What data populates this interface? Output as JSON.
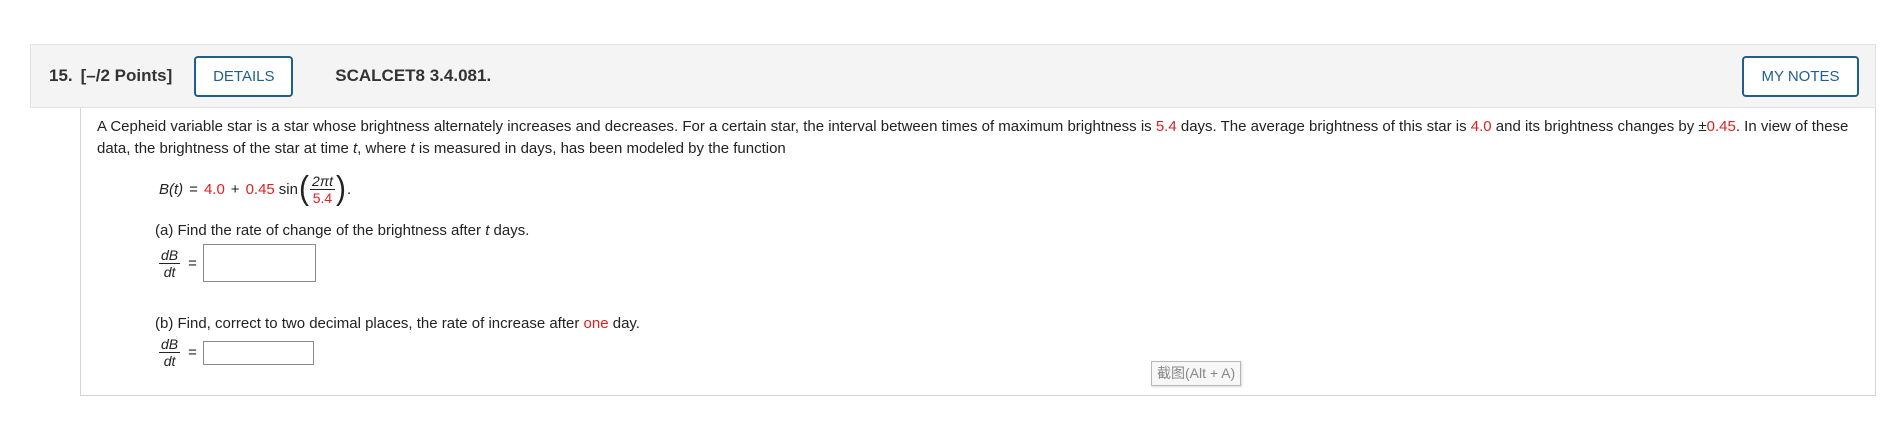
{
  "header": {
    "question_number": "15.",
    "points": "[–/2 Points]",
    "details_button": "DETAILS",
    "problem_code": "SCALCET8 3.4.081.",
    "notes_button": "MY NOTES"
  },
  "problem": {
    "text_1": "A Cepheid variable star is a star whose brightness alternately increases and decreases. For a certain star, the interval between times of maximum brightness is ",
    "period": "5.4",
    "text_2": " days. The average brightness of this star is ",
    "average": "4.0",
    "text_3": " and its brightness changes by ±",
    "change": "0.45",
    "text_4": ". In view of these data, the brightness of the star at time ",
    "var_t": "t",
    "text_5": ", where ",
    "text_6": " is measured in days, has been modeled by the function"
  },
  "formula": {
    "lhs": "B(t)",
    "eq": "=",
    "constant": "4.0",
    "plus": "+",
    "amplitude": "0.45",
    "func": "sin",
    "numerator": "2πt",
    "denominator": "5.4",
    "end": "."
  },
  "part_a": {
    "text": "(a) Find the rate of change of the brightness after ",
    "var": "t",
    "text_end": " days.",
    "deriv_num": "dB",
    "deriv_den": "dt",
    "eq": "=",
    "answer_value": ""
  },
  "part_b": {
    "text": "(b) Find, correct to two decimal places, the rate of increase after ",
    "highlight": "one",
    "text_end": " day.",
    "deriv_num": "dB",
    "deriv_den": "dt",
    "eq": "=",
    "answer_value": ""
  },
  "tooltip": "截图(Alt + A)",
  "colors": {
    "accent": "#1f5f8b",
    "highlight": "#e02020",
    "header_bg": "#f4f4f4"
  }
}
